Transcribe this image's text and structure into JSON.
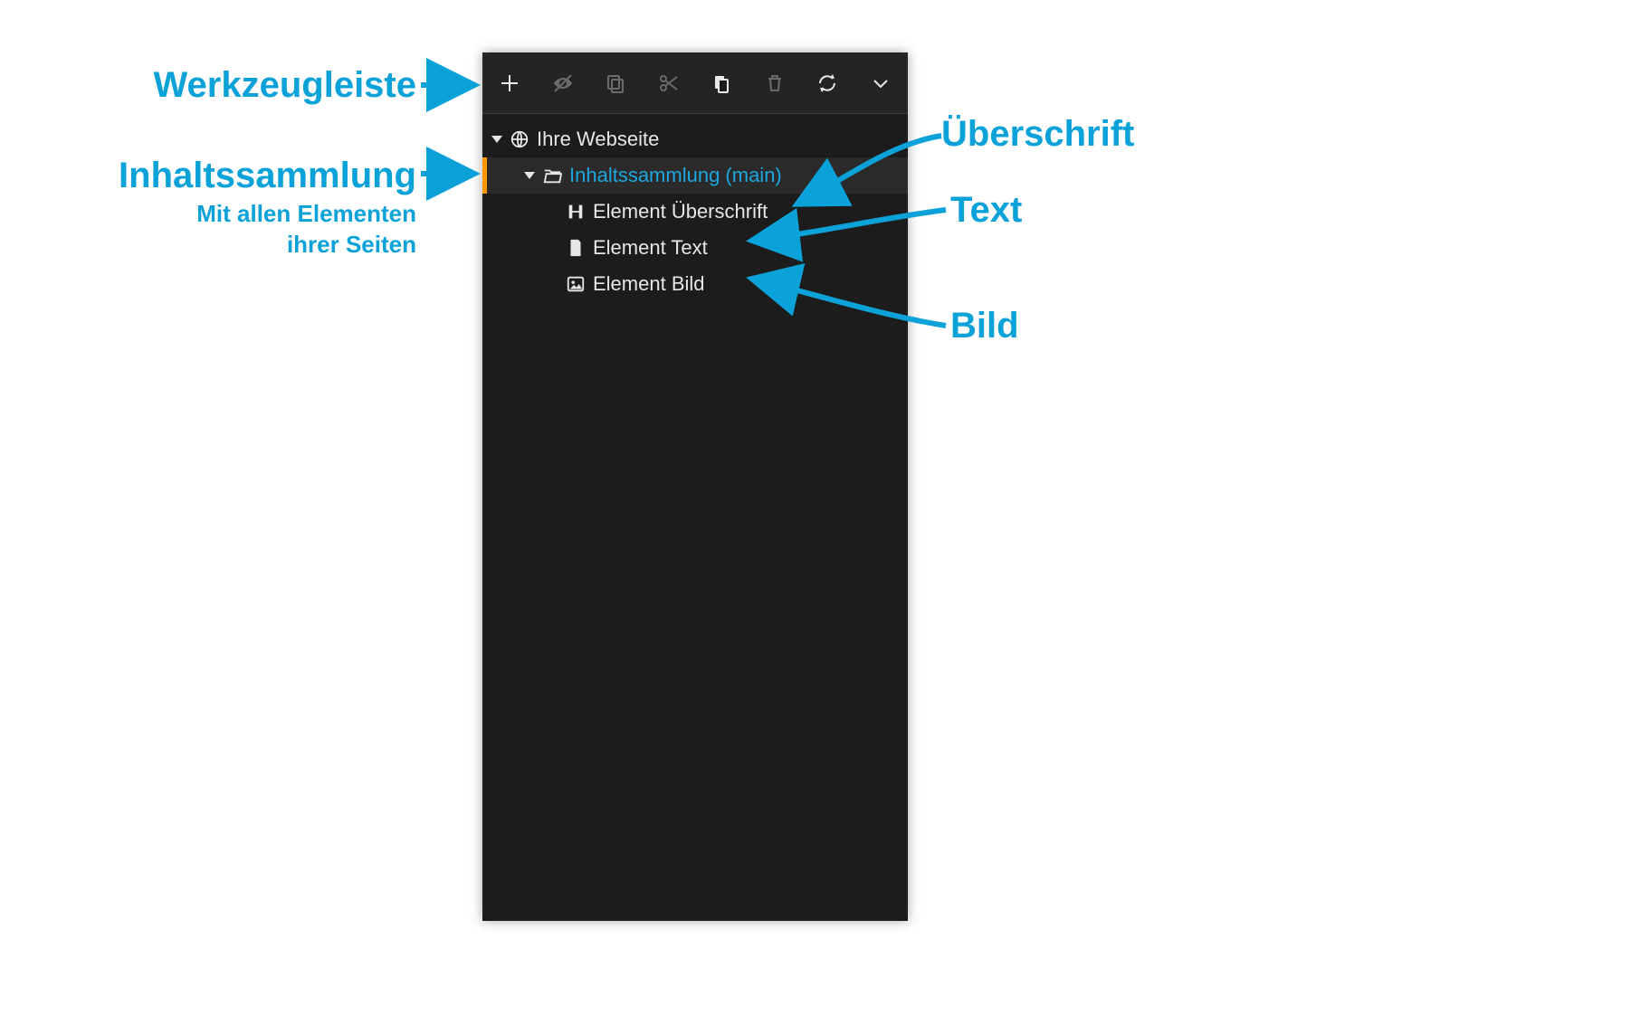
{
  "annotations": {
    "toolbar": "Werkzeugleiste",
    "collection": "Inhaltssammlung",
    "collection_sub1": "Mit allen Elementen",
    "collection_sub2": "ihrer Seiten",
    "heading": "Überschrift",
    "text": "Text",
    "image": "Bild"
  },
  "tree": {
    "root": "Ihre Webseite",
    "collection": "Inhaltssammlung (main)",
    "item_heading": "Element Überschrift",
    "item_text": "Element Text",
    "item_image": "Element Bild"
  }
}
